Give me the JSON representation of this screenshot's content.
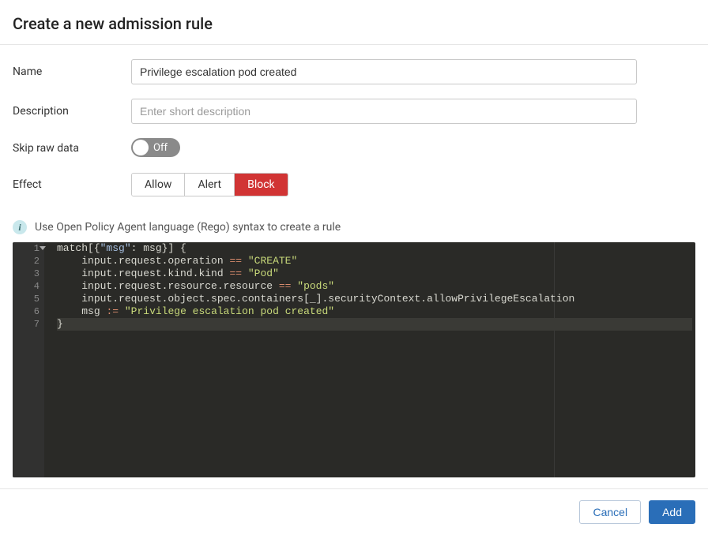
{
  "header": {
    "title": "Create a new admission rule"
  },
  "form": {
    "name": {
      "label": "Name",
      "value": "Privilege escalation pod created",
      "placeholder": ""
    },
    "description": {
      "label": "Description",
      "value": "",
      "placeholder": "Enter short description"
    },
    "skip_raw": {
      "label": "Skip raw data",
      "state": "Off"
    },
    "effect": {
      "label": "Effect",
      "options": [
        "Allow",
        "Alert",
        "Block"
      ],
      "selected": "Block"
    }
  },
  "info": {
    "text": "Use Open Policy Agent language (Rego) syntax to create a rule"
  },
  "editor": {
    "lines": [
      [
        {
          "t": "match",
          "c": "id"
        },
        {
          "t": "[{",
          "c": "pun"
        },
        {
          "t": "\"msg\"",
          "c": "key"
        },
        {
          "t": ": ",
          "c": "pun"
        },
        {
          "t": "msg",
          "c": "id"
        },
        {
          "t": "}] {",
          "c": "pun"
        }
      ],
      [
        {
          "t": "    ",
          "c": "pun"
        },
        {
          "t": "input.request.operation ",
          "c": "id"
        },
        {
          "t": "==",
          "c": "op"
        },
        {
          "t": " ",
          "c": "pun"
        },
        {
          "t": "\"CREATE\"",
          "c": "str"
        }
      ],
      [
        {
          "t": "    ",
          "c": "pun"
        },
        {
          "t": "input.request.kind.kind ",
          "c": "id"
        },
        {
          "t": "==",
          "c": "op"
        },
        {
          "t": " ",
          "c": "pun"
        },
        {
          "t": "\"Pod\"",
          "c": "str"
        }
      ],
      [
        {
          "t": "    ",
          "c": "pun"
        },
        {
          "t": "input.request.resource.resource ",
          "c": "id"
        },
        {
          "t": "==",
          "c": "op"
        },
        {
          "t": " ",
          "c": "pun"
        },
        {
          "t": "\"pods\"",
          "c": "str"
        }
      ],
      [
        {
          "t": "    ",
          "c": "pun"
        },
        {
          "t": "input.request.object.spec.containers[_].securityContext.allowPrivilegeEscalation",
          "c": "id"
        }
      ],
      [
        {
          "t": "    ",
          "c": "pun"
        },
        {
          "t": "msg ",
          "c": "id"
        },
        {
          "t": ":=",
          "c": "op"
        },
        {
          "t": " ",
          "c": "pun"
        },
        {
          "t": "\"Privilege escalation pod created\"",
          "c": "str"
        }
      ],
      [
        {
          "t": "}",
          "c": "pun"
        }
      ]
    ],
    "active_line": 7
  },
  "footer": {
    "cancel": "Cancel",
    "add": "Add"
  }
}
